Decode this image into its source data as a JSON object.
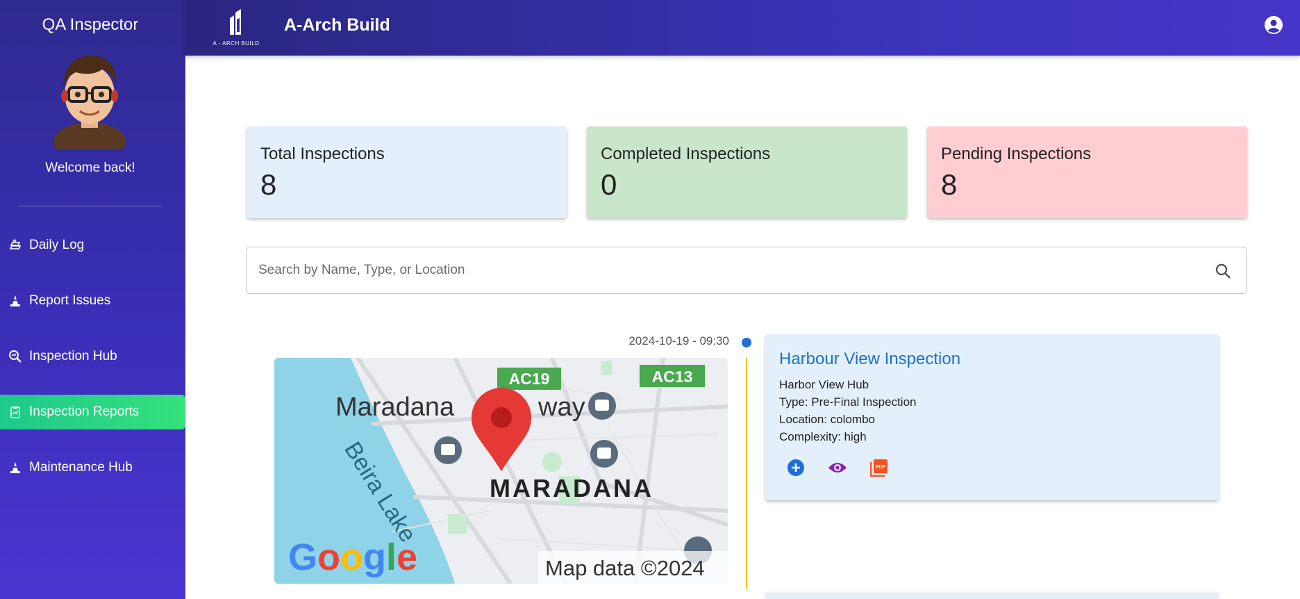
{
  "sidebar": {
    "role_title": "QA Inspector",
    "welcome": "Welcome back!",
    "items": [
      {
        "label": "Daily Log",
        "icon": "ledger-icon"
      },
      {
        "label": "Report Issues",
        "icon": "cone-icon"
      },
      {
        "label": "Inspection Hub",
        "icon": "search-document-icon"
      },
      {
        "label": "Inspection Reports",
        "icon": "report-icon",
        "active": true
      },
      {
        "label": "Maintenance Hub",
        "icon": "cone-icon"
      }
    ]
  },
  "header": {
    "logo_text": "A - ARCH BUILD",
    "title": "A-Arch Build"
  },
  "stats": {
    "total": {
      "label": "Total Inspections",
      "value": "8"
    },
    "completed": {
      "label": "Completed Inspections",
      "value": "0"
    },
    "pending": {
      "label": "Pending Inspections",
      "value": "8"
    }
  },
  "search": {
    "placeholder": "Search by Name, Type, or Location"
  },
  "timeline": [
    {
      "timestamp": "2024-10-19 - 09:30",
      "title": "Harbour View Inspection",
      "project": "Harbor View Hub",
      "type": "Type: Pre-Final Inspection",
      "location": "Location: colombo",
      "complexity": "Complexity: high",
      "map": {
        "labels": [
          "Maradana",
          "way",
          "MARADANA",
          "Beira Lake",
          "AC19",
          "AC13"
        ],
        "google": "Google",
        "copyright": "Map data ©2024"
      }
    }
  ],
  "colors": {
    "sidebar": "#3a2fb8",
    "active_nav": "#2fd684",
    "total_card": "#e3f0fb",
    "completed_card": "#c8e6c9",
    "pending_card": "#ffcdd2",
    "title_blue": "#1e6fc8",
    "timeline_line": "#f2c200"
  }
}
